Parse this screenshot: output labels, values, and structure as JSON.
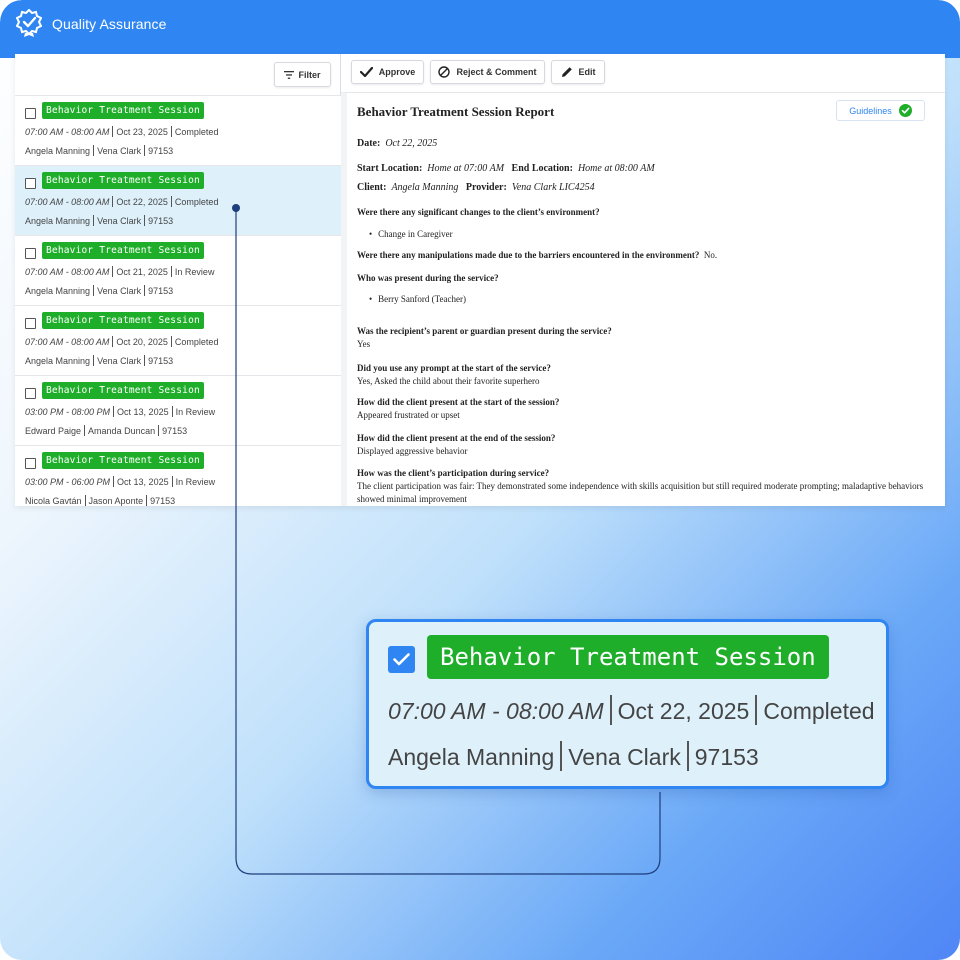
{
  "app": {
    "title": "Quality Assurance",
    "logo_icon": "badge-check-icon",
    "accent_color": "#2f86f2"
  },
  "left_pane": {
    "filter_label": "Filter",
    "filter_icon": "filter-lines-icon",
    "tag_color": "#1fae2a",
    "sessions": [
      {
        "tag": "Behavior Treatment Session",
        "time": "07:00 AM - 08:00 AM",
        "date": "Oct 23, 2025",
        "status": "Completed",
        "client": "Angela Manning",
        "provider": "Vena Clark",
        "code": "97153",
        "selected": false,
        "checked": false
      },
      {
        "tag": "Behavior Treatment Session",
        "time": "07:00 AM - 08:00 AM",
        "date": "Oct 22, 2025",
        "status": "Completed",
        "client": "Angela Manning",
        "provider": "Vena Clark",
        "code": "97153",
        "selected": true,
        "checked": false
      },
      {
        "tag": "Behavior Treatment Session",
        "time": "07:00 AM - 08:00 AM",
        "date": "Oct 21, 2025",
        "status": "In Review",
        "client": "Angela Manning",
        "provider": "Vena Clark",
        "code": "97153",
        "selected": false,
        "checked": false
      },
      {
        "tag": "Behavior Treatment Session",
        "time": "07:00 AM - 08:00 AM",
        "date": "Oct 20, 2025",
        "status": "Completed",
        "client": "Angela Manning",
        "provider": "Vena Clark",
        "code": "97153",
        "selected": false,
        "checked": false
      },
      {
        "tag": "Behavior Treatment Session",
        "time": "03:00 PM - 08:00 PM",
        "date": "Oct 13, 2025",
        "status": "In Review",
        "client": "Edward Paige",
        "provider": "Amanda Duncan",
        "code": "97153",
        "selected": false,
        "checked": false
      },
      {
        "tag": "Behavior Treatment Session",
        "time": "03:00 PM - 06:00 PM",
        "date": "Oct 13, 2025",
        "status": "In Review",
        "client": "Nicola Gavtán",
        "provider": "Jason Aponte",
        "code": "97153",
        "selected": false,
        "checked": false
      }
    ]
  },
  "toolbar": {
    "approve_label": "Approve",
    "reject_label": "Reject & Comment",
    "edit_label": "Edit"
  },
  "report": {
    "title": "Behavior Treatment Session Report",
    "guidelines_label": "Guidelines",
    "date_label": "Date:",
    "date_value": "Oct 22, 2025",
    "start_location_label": "Start Location:",
    "start_location_value": "Home at 07:00 AM",
    "end_location_label": "End Location:",
    "end_location_value": "Home at 08:00 AM",
    "client_label": "Client:",
    "client_value": "Angela Manning",
    "provider_label": "Provider:",
    "provider_value": "Vena Clark LIC4254",
    "q1": "Were there any significant changes to the client’s environment?",
    "q1_bullet": "Change in Caregiver",
    "q2": "Were there any manipulations made due to the barriers encountered in the environment?",
    "q2_answer": "No.",
    "q3": "Who was present during the service?",
    "q3_bullet": "Berry Sanford (Teacher)",
    "q4": "Was the recipient’s parent or guardian present during the service?",
    "q4_answer": "Yes",
    "q5": "Did you use any prompt at the start of the service?",
    "q5_answer": "Yes, Asked the child about their favorite superhero",
    "q6": "How did the client present at the start of the session?",
    "q6_answer": "Appeared frustrated or upset",
    "q7": "How did the client present at the end of the session?",
    "q7_answer": "Displayed aggressive behavior",
    "q8": "How was the client’s participation during service?",
    "q8_answer_1": "The client participation was fair: They demonstrated some independence with skills acquisition but still required moderate prompting; maladaptive behaviors",
    "q8_answer_2": "showed minimal improvement"
  },
  "callout": {
    "tag": "Behavior Treatment Session",
    "time": "07:00 AM - 08:00 AM",
    "date": "Oct 22, 2025",
    "status": "Completed",
    "client": "Angela Manning",
    "provider": "Vena Clark",
    "code": "97153",
    "checked": true
  }
}
